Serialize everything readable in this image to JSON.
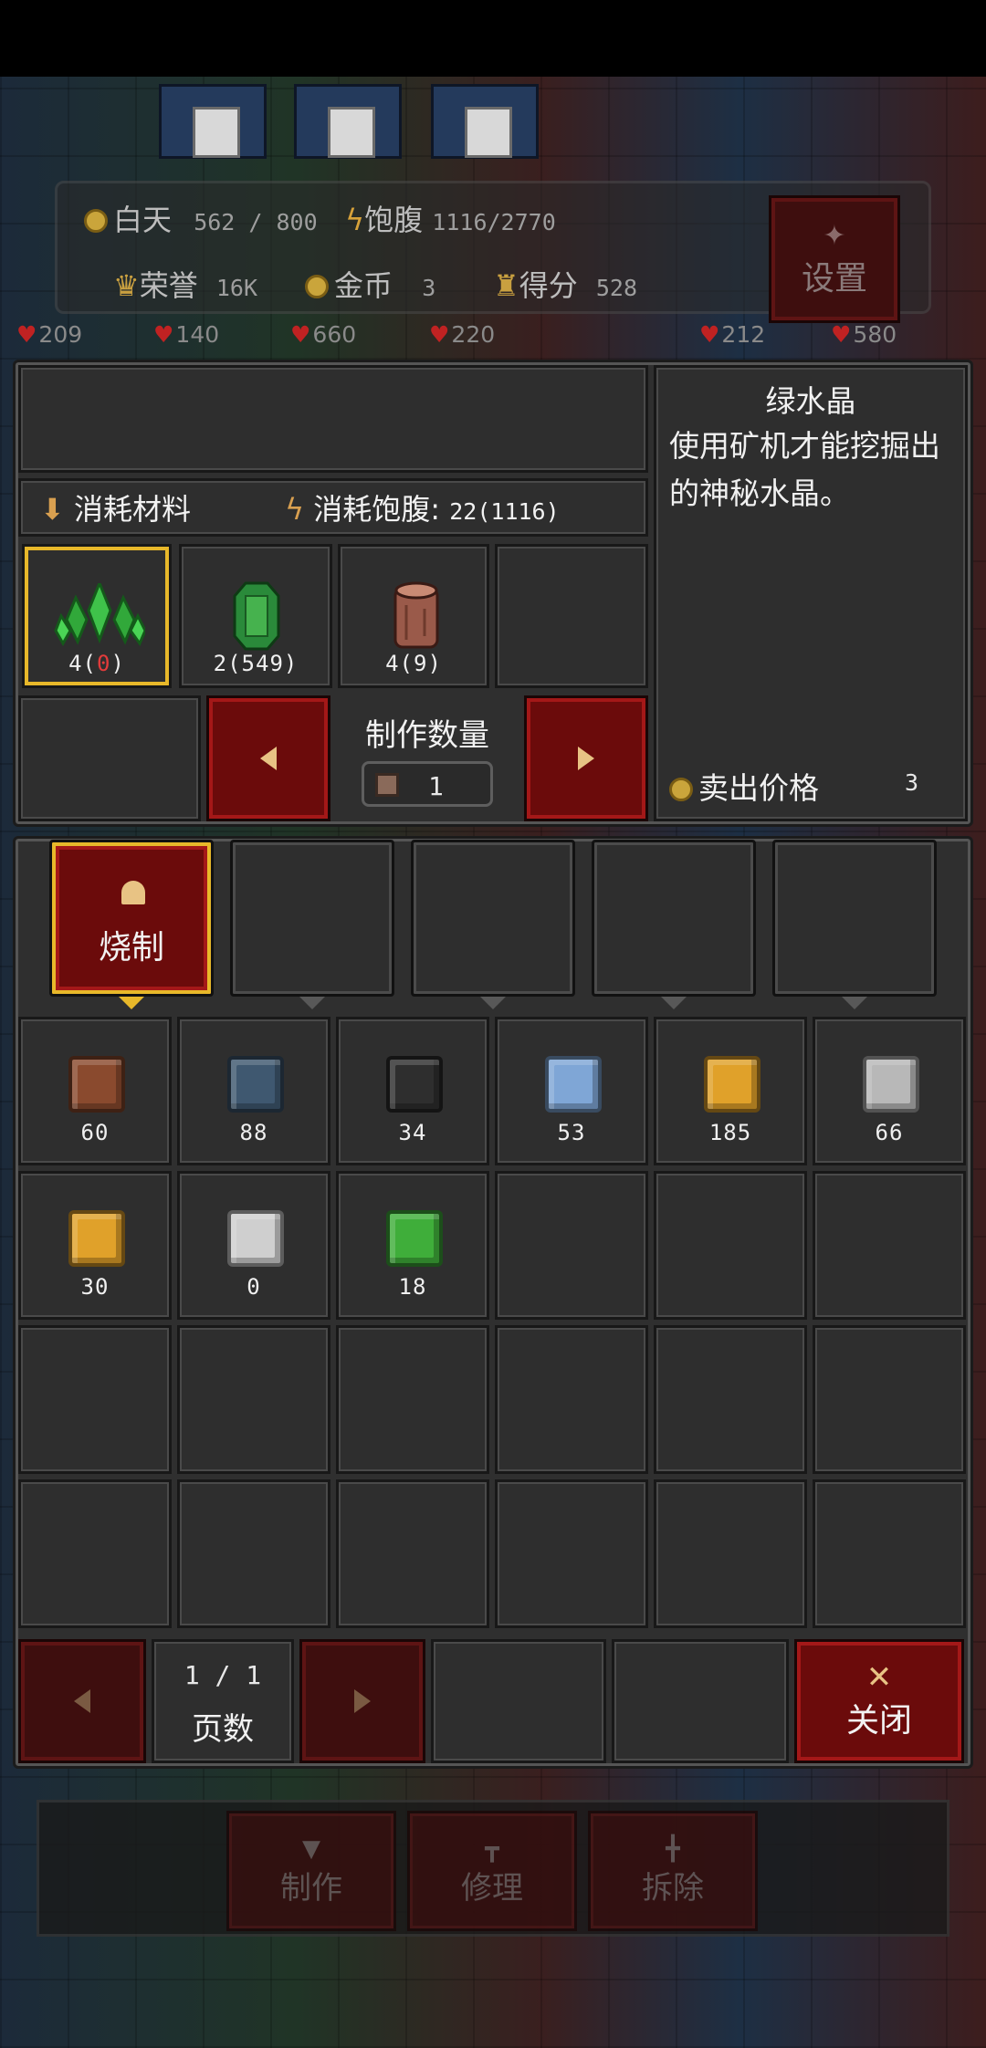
{
  "hud": {
    "daytime_label": "白天",
    "daytime_value": "562 / 800",
    "satiety_label": "饱腹",
    "satiety_value": "1116/2770",
    "honor_label": "荣誉",
    "honor_value": "16K",
    "gold_label": "金币",
    "gold_value": "3",
    "score_label": "得分",
    "score_value": "528",
    "settings_label": "设置"
  },
  "world_hp": [
    "209",
    "140",
    "660",
    "220",
    "212",
    "580"
  ],
  "craft": {
    "consume_materials_label": "消耗材料",
    "consume_satiety_label": "消耗饱腹:",
    "consume_satiety_value": "22(1116)",
    "materials": [
      {
        "icon": "green-crystal-icon",
        "need": "4",
        "have": "0",
        "have_color": "#e23b3b",
        "selected": true
      },
      {
        "icon": "emerald-gem-icon",
        "need": "2",
        "have": "549"
      },
      {
        "icon": "wood-log-icon",
        "need": "4",
        "have": "9"
      }
    ],
    "quantity_label": "制作数量",
    "quantity_value": "1"
  },
  "detail": {
    "item_name": "绿水晶",
    "description": "使用矿机才能挖掘出的神秘水晶。",
    "sell_price_label": "卖出价格",
    "sell_price_value": "3"
  },
  "tabs": [
    {
      "label": "烧制",
      "active": true
    },
    {
      "label": "",
      "active": false
    },
    {
      "label": "",
      "active": false
    },
    {
      "label": "",
      "active": false
    },
    {
      "label": "",
      "active": false
    }
  ],
  "inventory": [
    {
      "icon": "brick-icon",
      "count": "60",
      "color": "#8a4a2e"
    },
    {
      "icon": "stone-brick-icon",
      "count": "88",
      "color": "#3f5870"
    },
    {
      "icon": "dark-brick-icon",
      "count": "34",
      "color": "#2e2e2e"
    },
    {
      "icon": "glass-block-icon",
      "count": "53",
      "color": "#7fa6d6"
    },
    {
      "icon": "gold-ore-icon",
      "count": "185",
      "color": "#e0a12a"
    },
    {
      "icon": "iron-ingot-icon",
      "count": "66",
      "color": "#b8b8b8"
    },
    {
      "icon": "gold-ingot-icon",
      "count": "30",
      "color": "#e0a12a"
    },
    {
      "icon": "silver-ore-icon",
      "count": "0",
      "color": "#cfcfcf"
    },
    {
      "icon": "green-block-icon",
      "count": "18",
      "color": "#3fae3a"
    }
  ],
  "pagination": {
    "page_value": "1 / 1",
    "page_label": "页数"
  },
  "close_label": "关闭",
  "bottom_bar": {
    "craft_label": "制作",
    "repair_label": "修理",
    "dismantle_label": "拆除"
  }
}
